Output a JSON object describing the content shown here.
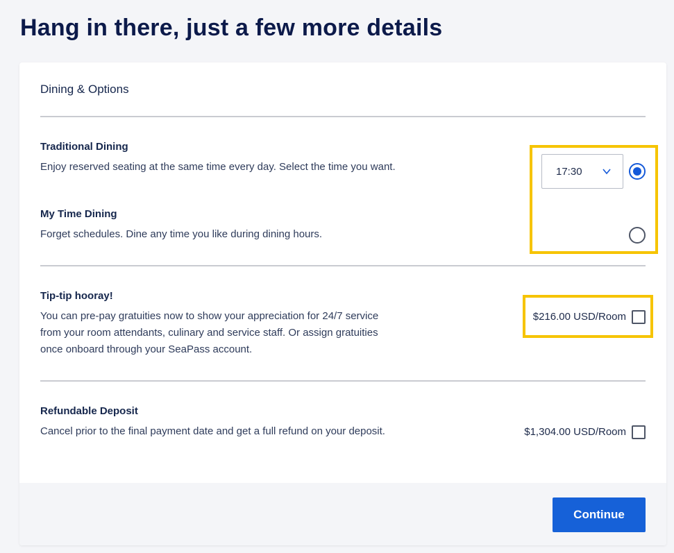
{
  "page": {
    "title": "Hang in there, just a few more details"
  },
  "card": {
    "title": "Dining & Options"
  },
  "dining": {
    "traditional": {
      "title": "Traditional Dining",
      "description": "Enjoy reserved seating at the same time every day. Select the time you want.",
      "selected": true
    },
    "my_time": {
      "title": "My Time Dining",
      "description": "Forget schedules. Dine any time you like during dining hours.",
      "selected": false
    },
    "time_select": {
      "value": "17:30",
      "icon": "chevron-down-icon"
    }
  },
  "gratuity": {
    "title": "Tip-tip hooray!",
    "description_lines": [
      "You can pre-pay gratuities now to show your appreciation for 24/7 service",
      "from your room attendants, culinary and service staff. Or assign gratuities",
      "once onboard through your SeaPass account."
    ],
    "price": "$216.00 USD/Room",
    "checked": false
  },
  "deposit": {
    "title": "Refundable Deposit",
    "description": "Cancel prior to the final payment date and get a full refund on your deposit.",
    "price": "$1,304.00 USD/Room",
    "checked": false
  },
  "footer": {
    "continue_label": "Continue"
  },
  "colors": {
    "accent": "#1661d8",
    "highlight": "#f6c400",
    "heading": "#0c1a4a"
  }
}
